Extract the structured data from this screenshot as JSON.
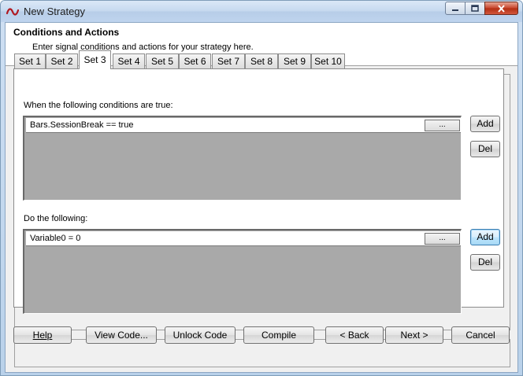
{
  "window": {
    "title": "New Strategy",
    "controls": {
      "minimize": "–",
      "maximize": "□",
      "close": "✕"
    }
  },
  "header": {
    "title": "Conditions and Actions",
    "subtitle": "Enter signal conditions and actions for your strategy here."
  },
  "tabs": [
    "Set 1",
    "Set 2",
    "Set 3",
    "Set 4",
    "Set 5",
    "Set 6",
    "Set 7",
    "Set 8",
    "Set 9",
    "Set 10"
  ],
  "active_tab": "Set 3",
  "conditions": {
    "label": "When the following conditions are true:",
    "items": [
      "Bars.SessionBreak == true"
    ],
    "browse_label": "...",
    "add_label": "Add",
    "del_label": "Del"
  },
  "actions": {
    "label": "Do the following:",
    "items": [
      "Variable0 = 0"
    ],
    "browse_label": "...",
    "add_label": "Add",
    "del_label": "Del"
  },
  "footer": {
    "help": "Help",
    "view_code": "View Code...",
    "unlock_code": "Unlock Code",
    "compile": "Compile",
    "back": "< Back",
    "next": "Next >",
    "cancel": "Cancel"
  }
}
